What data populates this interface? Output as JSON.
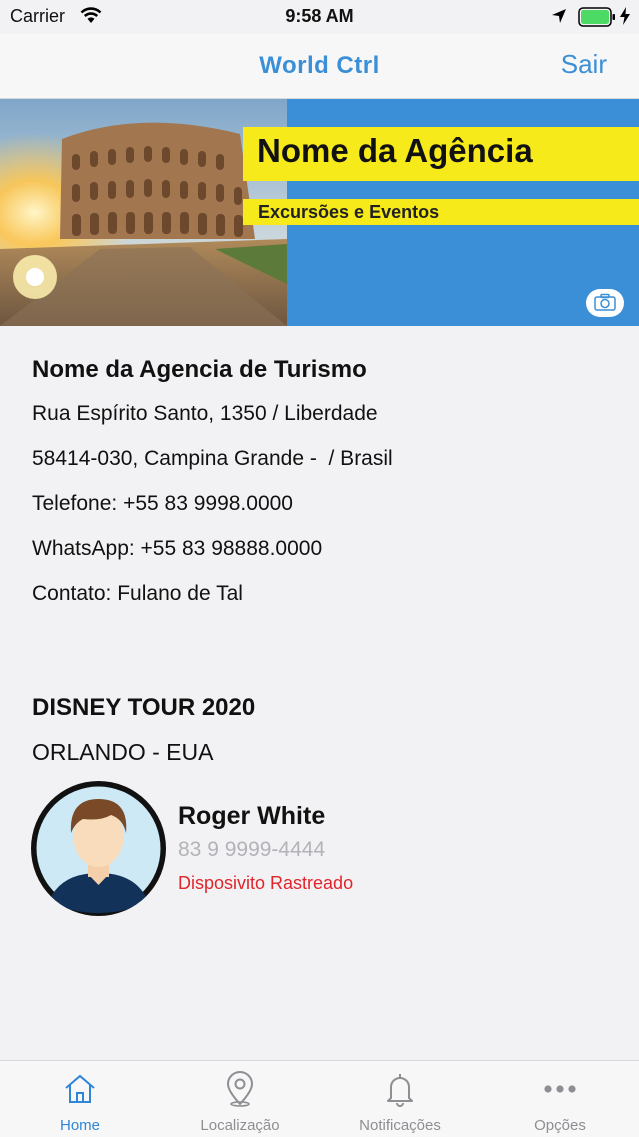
{
  "status_bar": {
    "carrier": "Carrier",
    "time": "9:58 AM"
  },
  "nav": {
    "logo": "World Ctrl",
    "logout_label": "Sair"
  },
  "banner": {
    "agency_name": "Nome da Agência",
    "subtitle": "Excursões e Eventos",
    "camera_icon": "camera-icon",
    "colors": {
      "background": "#3a8fd6",
      "strip": "#f7ea1a"
    }
  },
  "agency": {
    "name": "Nome da Agencia de Turismo",
    "address": "Rua Espírito Santo, 1350 / Liberdade",
    "city_line": "58414-030, Campina Grande -  / Brasil",
    "phone": "Telefone: +55 83 9998.0000",
    "whatsapp": "WhatsApp: +55 83 98888.0000",
    "contact": "Contato: Fulano de Tal"
  },
  "tour": {
    "title": "DISNEY TOUR 2020",
    "destination": "ORLANDO - EUA"
  },
  "traveler": {
    "name": "Roger White",
    "phone": "83 9 9999-4444",
    "status": "Disposivito Rastreado",
    "status_color": "#e0252b"
  },
  "tabbar": {
    "tabs": [
      {
        "label": "Home",
        "icon": "home-icon",
        "active": true
      },
      {
        "label": "Localização",
        "icon": "location-pin-icon",
        "active": false
      },
      {
        "label": "Notificações",
        "icon": "bell-icon",
        "active": false
      },
      {
        "label": "Opções",
        "icon": "more-dots-icon",
        "active": false
      }
    ],
    "active_color": "#2f86d6"
  }
}
